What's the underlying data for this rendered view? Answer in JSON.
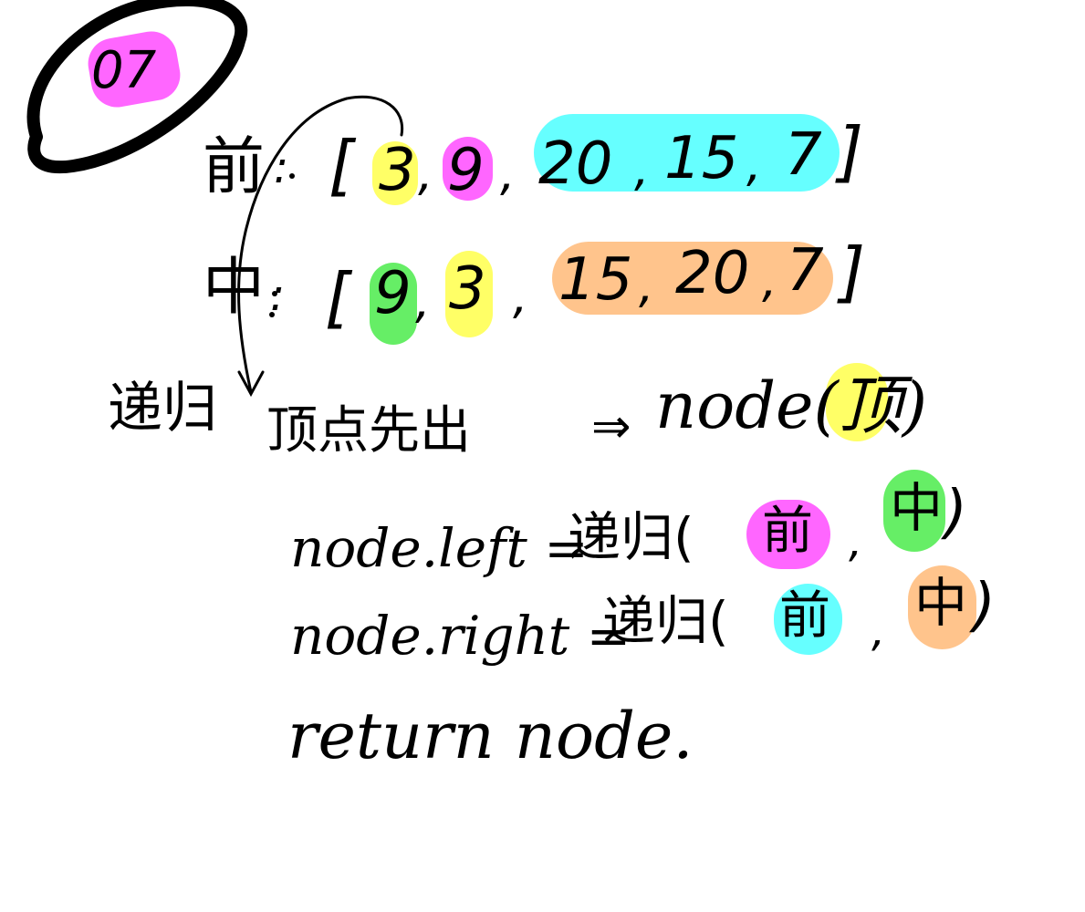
{
  "badge": {
    "text": "07"
  },
  "colors": {
    "pink": "#ff66ff",
    "yellow": "#ffff66",
    "cyan": "#66ffff",
    "green": "#66ee66",
    "orange": "#ffc48c"
  },
  "preorder": {
    "label": "前",
    "colon": ":",
    "open": "[",
    "items": [
      "3",
      ",",
      "9",
      ",",
      "20",
      ",",
      "15",
      ",",
      "7"
    ],
    "close": "]"
  },
  "inorder": {
    "label": "中",
    "colon": ":",
    "open": "[",
    "items": [
      "9",
      ",",
      "3",
      ",",
      "15",
      ",",
      "20",
      ",",
      "7"
    ],
    "close": "]"
  },
  "recursion_label": "递归",
  "code": {
    "line1_left": "顶点先出",
    "line1_arrow": "⇒",
    "line1_right": "node(顶)",
    "line2_left": "node.left =",
    "line2_call": "递归(",
    "line2_arg1": "前",
    "line2_sep": ",",
    "line2_arg2": "中",
    "line2_close": ")",
    "line3_left": "node.right =",
    "line3_call": "递归(",
    "line3_arg1": "前",
    "line3_sep": ",",
    "line3_arg2": "中",
    "line3_close": ")",
    "line4": "return node."
  }
}
